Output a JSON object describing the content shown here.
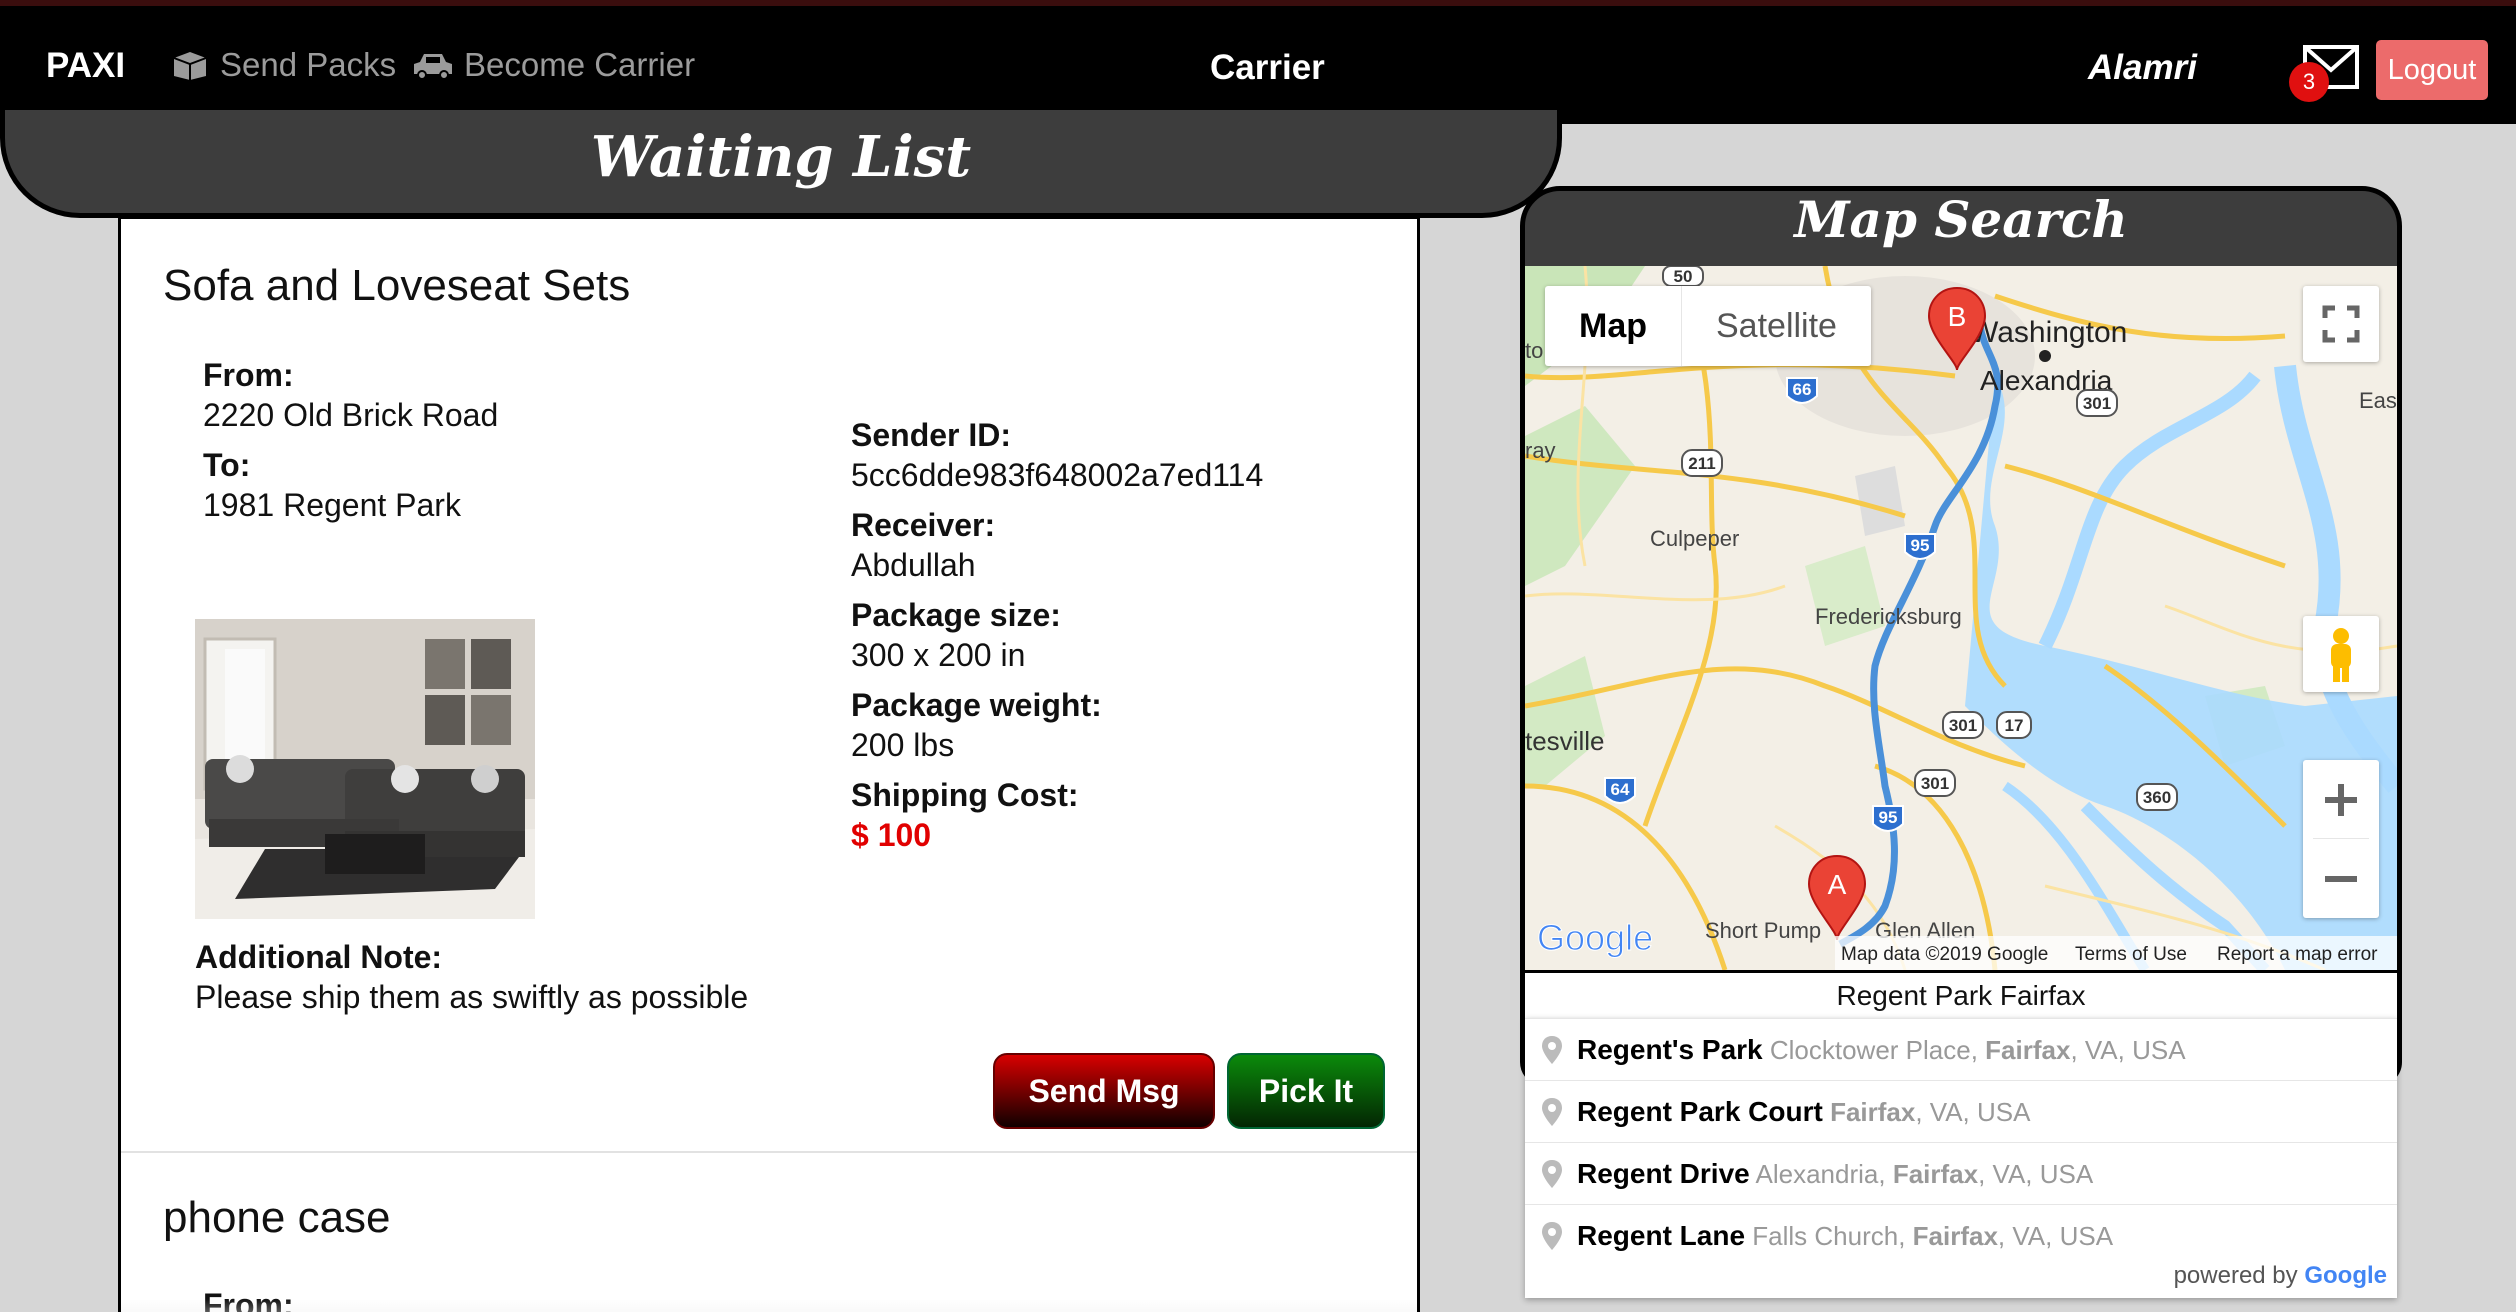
{
  "nav": {
    "brand": "PAXI",
    "send_packs": "Send Packs",
    "become_carrier": "Become Carrier",
    "center": "Carrier",
    "user": "Alamri",
    "message_count": "3",
    "logout": "Logout"
  },
  "waiting_list": {
    "title": "Waiting List",
    "packages": [
      {
        "title": "Sofa and Loveseat Sets",
        "from_label": "From:",
        "from": "2220 Old Brick Road",
        "to_label": "To:",
        "to": "1981 Regent Park",
        "sender_label": "Sender ID:",
        "sender_id": "5cc6dde983f648002a7ed114",
        "receiver_label": "Receiver:",
        "receiver": "Abdullah",
        "size_label": "Package size:",
        "size": "300 x 200 in",
        "weight_label": "Package weight:",
        "weight": "200 lbs",
        "cost_label": "Shipping Cost:",
        "cost": "$ 100",
        "note_label": "Additional Note:",
        "note": "Please ship them as swiftly as possible",
        "send_msg": "Send Msg",
        "pick_it": "Pick It"
      },
      {
        "title": "phone case",
        "from_label": "From:"
      }
    ]
  },
  "map_search": {
    "title": "Map Search",
    "map_type": {
      "map": "Map",
      "satellite": "Satellite"
    },
    "labels": {
      "washington": "Washington",
      "alexandria": "Alexandria",
      "culpeper": "Culpeper",
      "fredericksburg": "Fredericksburg",
      "esville": "tesville",
      "short_pump": "Short Pump",
      "glen_allen": "Glen Allen",
      "east": "Eas",
      "ray": "ray",
      "to": "to"
    },
    "route_shields": [
      "66",
      "301",
      "211",
      "95",
      "301",
      "17",
      "301",
      "64",
      "95",
      "360",
      "50"
    ],
    "markers": {
      "start": "A",
      "end": "B"
    },
    "attribution": {
      "google": "Google",
      "data": "Map data ©2019 Google",
      "terms": "Terms of Use",
      "report": "Report a map error"
    },
    "search_value": "Regent Park Fairfax",
    "suggestions": [
      {
        "main": "Regent's Park",
        "secondary_pre": "Clocktower Place, ",
        "secondary_bold": "Fairfax",
        "secondary_post": ", VA, USA"
      },
      {
        "main": "Regent Park Court",
        "secondary_pre": "",
        "secondary_bold": "Fairfax",
        "secondary_post": ", VA, USA"
      },
      {
        "main": "Regent Drive",
        "secondary_pre": "Alexandria, ",
        "secondary_bold": "Fairfax",
        "secondary_post": ", VA, USA"
      },
      {
        "main": "Regent Lane",
        "secondary_pre": "Falls Church, ",
        "secondary_bold": "Fairfax",
        "secondary_post": ", VA, USA"
      }
    ],
    "powered_by": "powered by",
    "powered_google": "Google"
  },
  "colors": {
    "accent_red": "#e10000",
    "logout": "#ec6b6b",
    "route": "#4a90d9"
  },
  "icons": [
    "box-icon",
    "car-icon",
    "mail-icon",
    "fullscreen-icon",
    "pegman-icon",
    "zoom-in-icon",
    "zoom-out-icon",
    "map-pin-icon"
  ]
}
